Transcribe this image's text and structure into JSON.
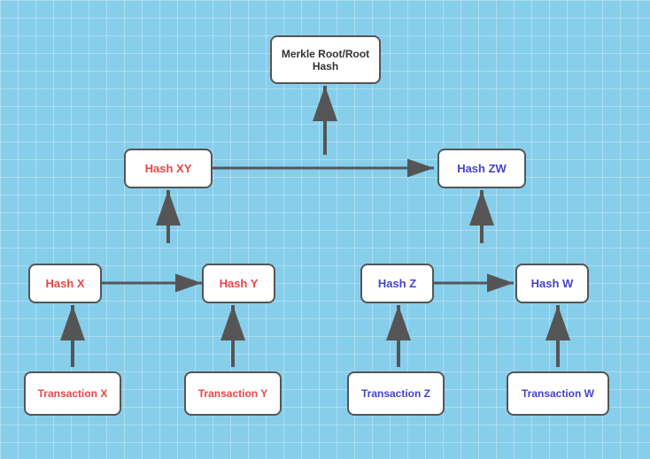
{
  "nodes": {
    "merkle": {
      "label_line1": "Merkle Root/Root",
      "label_line2": "Hash"
    },
    "hash_xy": {
      "label": "Hash XY"
    },
    "hash_zw": {
      "label": "Hash ZW"
    },
    "hash_x": {
      "label": "Hash X"
    },
    "hash_y": {
      "label": "Hash Y"
    },
    "hash_z": {
      "label": "Hash Z"
    },
    "hash_w": {
      "label": "Hash W"
    },
    "tx_x": {
      "label": "Transaction X"
    },
    "tx_y": {
      "label": "Transaction Y"
    },
    "tx_z": {
      "label": "Transaction Z"
    },
    "tx_w": {
      "label": "Transaction W"
    }
  }
}
